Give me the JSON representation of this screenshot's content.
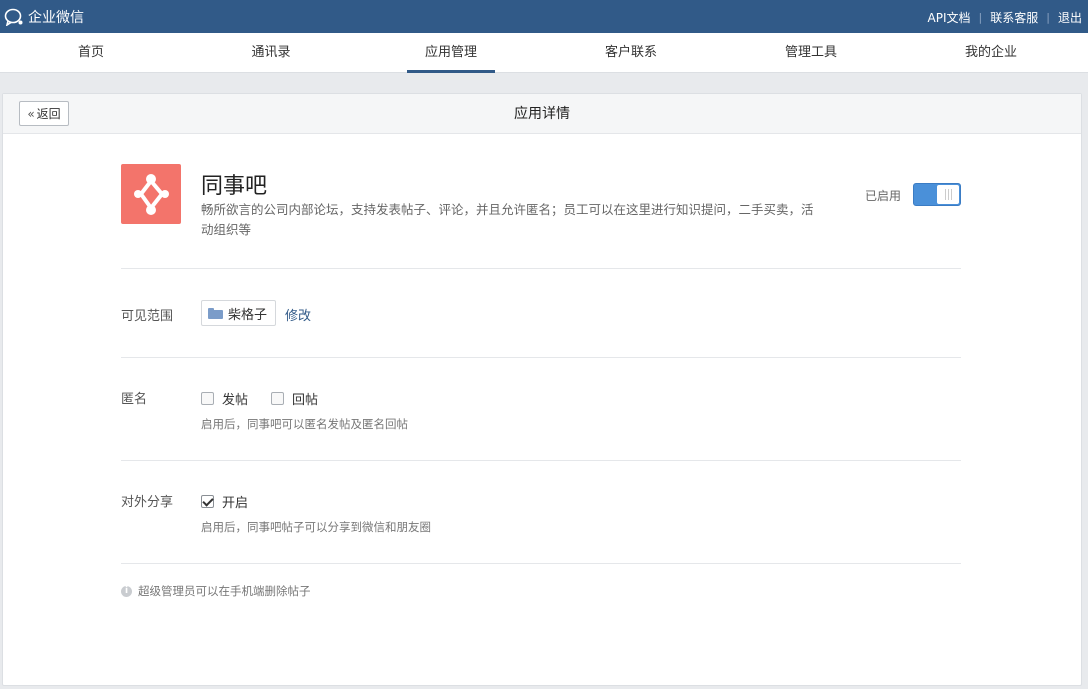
{
  "header": {
    "brand": "企业微信",
    "links": [
      "API文档",
      "联系客服",
      "退出"
    ]
  },
  "nav": {
    "tabs": [
      "首页",
      "通讯录",
      "应用管理",
      "客户联系",
      "管理工具",
      "我的企业"
    ],
    "active_index": 2
  },
  "panel": {
    "back_label": "返回",
    "title": "应用详情"
  },
  "app": {
    "name": "同事吧",
    "description": "畅所欲言的公司内部论坛，支持发表帖子、评论，并且允许匿名；员工可以在这里进行知识提问，二手买卖，活动组织等",
    "icon_color": "#f3746b",
    "status_label": "已启用",
    "enabled": true
  },
  "visibility": {
    "label": "可见范围",
    "scope": "柴格子",
    "edit_label": "修改"
  },
  "anonymous": {
    "label": "匿名",
    "options": [
      {
        "label": "发帖",
        "checked": false
      },
      {
        "label": "回帖",
        "checked": false
      }
    ],
    "hint": "启用后，同事吧可以匿名发帖及匿名回帖"
  },
  "sharing": {
    "label": "对外分享",
    "option_label": "开启",
    "checked": true,
    "hint": "启用后，同事吧帖子可以分享到微信和朋友圈"
  },
  "note": "超级管理员可以在手机端删除帖子"
}
